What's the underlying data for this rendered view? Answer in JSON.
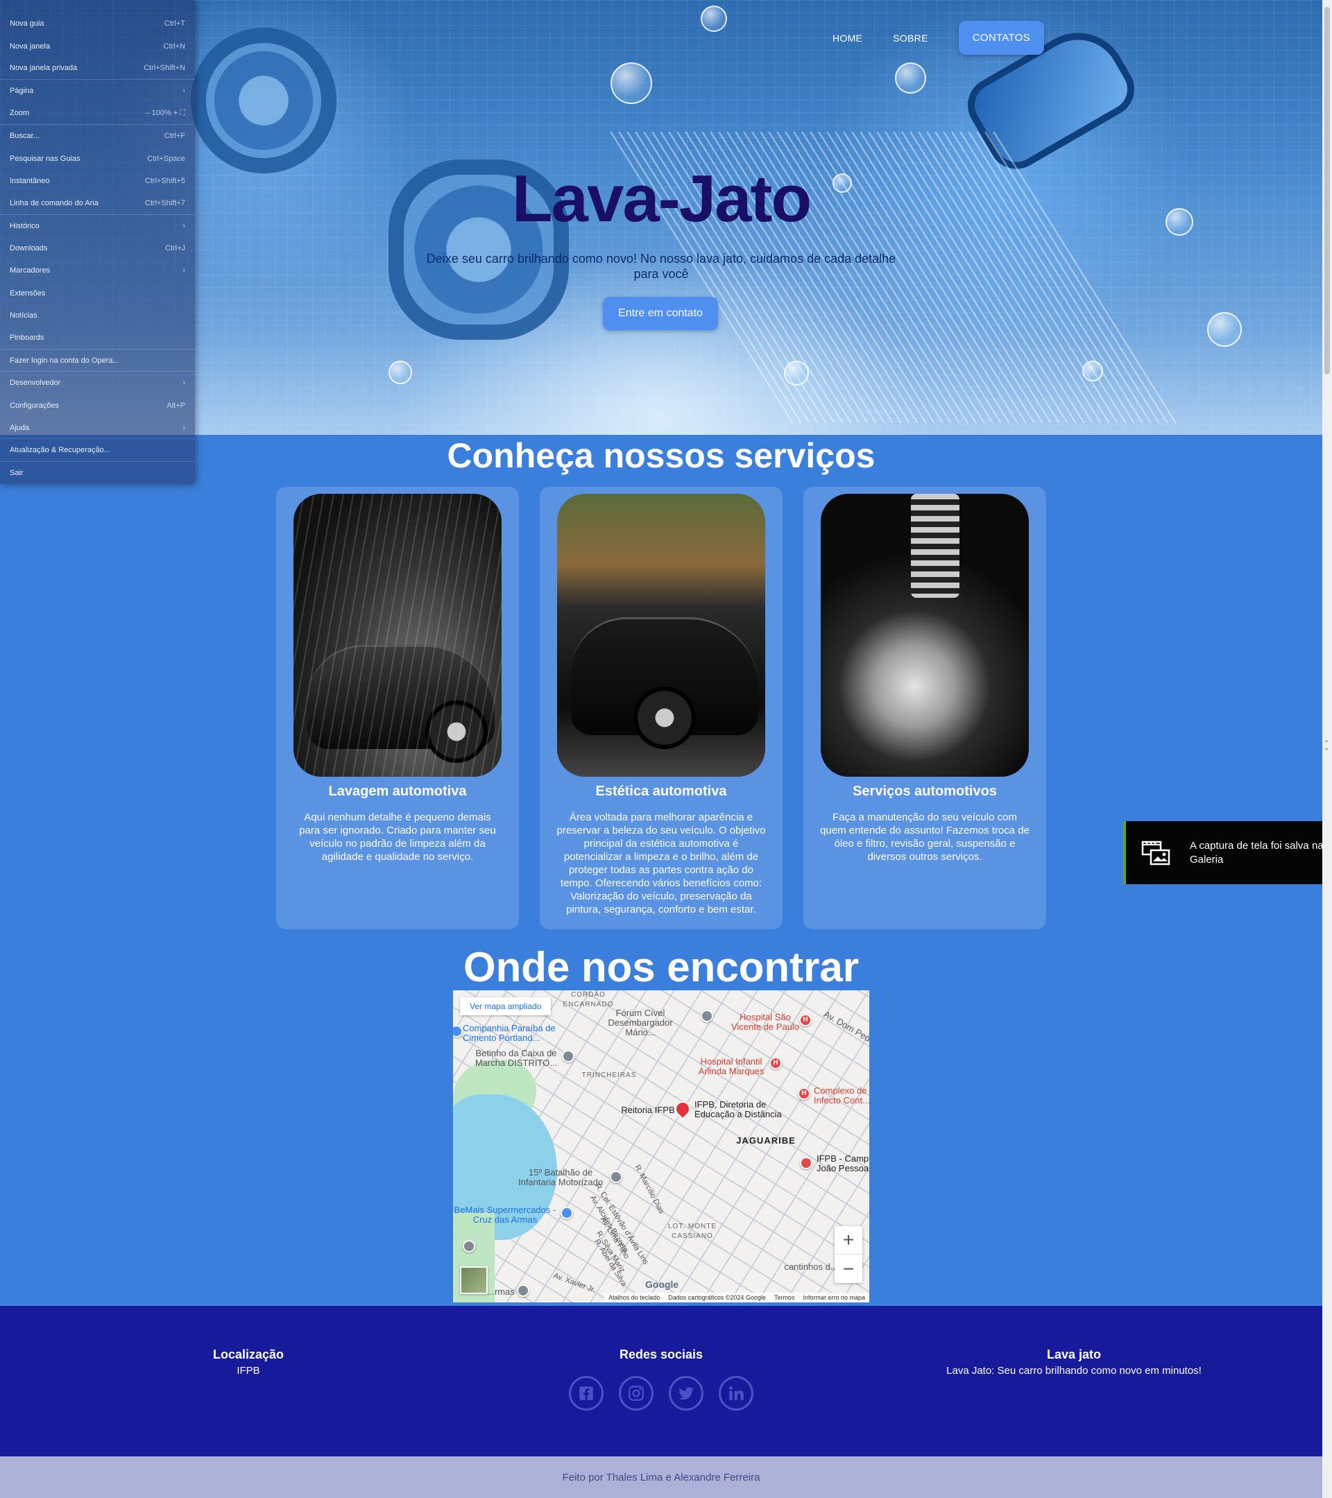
{
  "nav": {
    "home": "HOME",
    "sobre": "SOBRE",
    "contatos": "CONTATOS"
  },
  "hero": {
    "title": "Lava-Jato",
    "subtitle": "Deixe seu carro brilhando como novo! No nosso lava jato, cuidamos de cada detalhe para você",
    "cta": "Entre em contato"
  },
  "services": {
    "title": "Conheça nossos serviços",
    "cards": [
      {
        "title": "Lavagem automotiva",
        "text": "Aqui nenhum detalhe é pequeno demais para ser ignorado. Criado para manter seu veículo no padrão de limpeza além da agilidade e qualidade no serviço."
      },
      {
        "title": "Estética automotiva",
        "text": "Área voltada para melhorar aparência e preservar a beleza do seu veículo. O objetivo principal da estética automotiva é potencializar a limpeza e o brilho, além de proteger todas as partes contra ação do tempo. Oferecendo vários benefícios como: Valorização do veículo, preservação da pintura, segurança, conforto e bem estar."
      },
      {
        "title": "Serviços automotivos",
        "text": "Faça a manutenção do seu veículo com quem entende do assunto! Fazemos troca de óleo e filtro, revisão geral, suspensão e diversos outros serviços."
      }
    ]
  },
  "location": {
    "title": "Onde nos encontrar",
    "map": {
      "view_larger": "Ver mapa ampliado",
      "labels": {
        "cordao": "CORDÃO ENCARNADO",
        "forum": "Fórum Cível Desembargador Mário...",
        "hospital_sao_vicente": "Hospital São Vicente de Paulo",
        "av_dom_pedro": "Av. Dom Pedro",
        "companhia": "Companhia Paraíba de Cimento Portland...",
        "betinho": "Betinho da Caixa de Marcha DISTRITO...",
        "hospital_infantil": "Hospital Infantil Arlinda Marques",
        "trincheiras": "TRINCHEIRAS",
        "complexo": "Complexo de Infecto Cont...",
        "reitoria": "Reitoria IFPB",
        "ifpb_diretoria": "IFPB, Diretoria de Educação a Distância",
        "jaguaribe": "JAGUARIBE",
        "ifpb_campus": "IFPB - Campus João Pessoa",
        "batalhao": "15º Batalhão de Infantaria Motorizado",
        "bemais": "BeMais Supermercados - Cruz das Armas",
        "lot_monte": "LOT. MONTE CASSIANO",
        "r_marcilio": "R. Marcílio Dias",
        "av_alcides": "Av. Alcides Bezerra",
        "r_cel": "R. Cel. Estêvão d'Ávila Lins",
        "av_lima": "Av. Lima Filho",
        "r_silva": "R. Silva Mariz",
        "r_abel": "R. Abel da Silva",
        "av_xavier": "Av. Xavier Jr.",
        "cantinhos": "cantinhos d...",
        "cruz_armas": "...rmas"
      },
      "footer": {
        "shortcuts": "Atalhos do teclado",
        "data": "Dados cartográficos ©2024 Google",
        "terms": "Termos",
        "report": "Informar erro no mapa"
      },
      "logo": "Google"
    }
  },
  "footer": {
    "location_title": "Localização",
    "location_text": "IFPB",
    "social_title": "Redes sociais",
    "brand_title": "Lava jato",
    "brand_text": "Lava Jato: Seu carro brilhando como novo em minutos!",
    "social_icons": [
      "facebook-icon",
      "instagram-icon",
      "twitter-icon",
      "linkedin-icon"
    ]
  },
  "credits": "Feito por Thales Lima e Alexandre Ferreira",
  "browser_menu": [
    {
      "label": "Nova guia",
      "shortcut": "Ctrl+T"
    },
    {
      "label": "Nova janela",
      "shortcut": "Ctrl+N"
    },
    {
      "label": "Nova janela privada",
      "shortcut": "Ctrl+Shift+N"
    },
    {
      "label": "Página",
      "shortcut": "›"
    },
    {
      "label": "Zoom",
      "shortcut": "–  100%  +  ⛶"
    },
    {
      "label": "Buscar...",
      "shortcut": "Ctrl+F"
    },
    {
      "label": "Pesquisar nas Guias",
      "shortcut": "Ctrl+Space"
    },
    {
      "label": "Instantâneo",
      "shortcut": "Ctrl+Shift+5"
    },
    {
      "label": "Linha de comando do Aria",
      "shortcut": "Ctrl+Shift+7"
    },
    {
      "label": "Histórico",
      "shortcut": "›"
    },
    {
      "label": "Downloads",
      "shortcut": "Ctrl+J"
    },
    {
      "label": "Marcadores",
      "shortcut": "›"
    },
    {
      "label": "Extensões",
      "shortcut": ""
    },
    {
      "label": "Notícias",
      "shortcut": ""
    },
    {
      "label": "Pinboards",
      "shortcut": ""
    },
    {
      "label": "Fazer login na conta do Opera...",
      "shortcut": ""
    },
    {
      "label": "Desenvolvedor",
      "shortcut": "›"
    },
    {
      "label": "Configurações",
      "shortcut": "Alt+P"
    },
    {
      "label": "Ajuda",
      "shortcut": "›"
    },
    {
      "label": "Atualização & Recuperação...",
      "shortcut": ""
    },
    {
      "label": "Sair",
      "shortcut": ""
    }
  ],
  "toast": {
    "text": "A captura de tela foi salva na Galeria"
  },
  "colors": {
    "page_bg": "#3b7fdc",
    "accent_button": "#4e8ff0",
    "footer_bg": "#171a9a",
    "credits_bg": "#aeb1d7",
    "hero_title": "#1a0f66"
  }
}
